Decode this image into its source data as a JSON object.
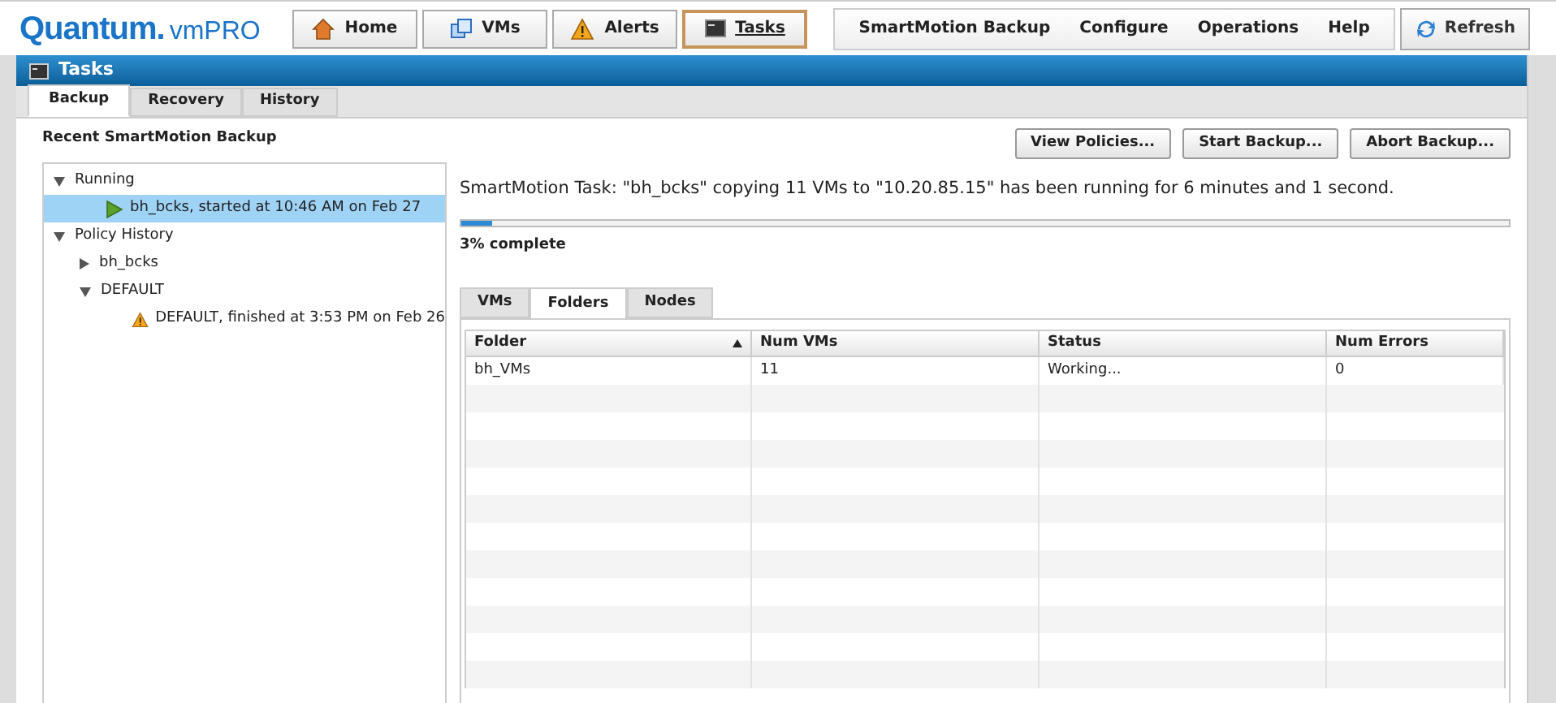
{
  "logo": {
    "brand": "Quantum.",
    "product": "vmPRO"
  },
  "nav": [
    {
      "label": "Home",
      "kind": "home",
      "selected": false
    },
    {
      "label": "VMs",
      "kind": "vms",
      "selected": false
    },
    {
      "label": "Alerts",
      "kind": "alert",
      "selected": false
    },
    {
      "label": "Tasks",
      "kind": "tasks",
      "selected": true
    }
  ],
  "menu": [
    "SmartMotion Backup",
    "Configure",
    "Operations",
    "Help"
  ],
  "refresh": "Refresh",
  "title_bar": "Tasks",
  "tabs": [
    {
      "label": "Backup",
      "selected": true
    },
    {
      "label": "Recovery",
      "selected": false
    },
    {
      "label": "History",
      "selected": false
    }
  ],
  "sidebar": {
    "title": "Recent SmartMotion Backup",
    "tree": [
      {
        "label": "Running",
        "expanded": true,
        "children": [
          {
            "label": "bh_bcks, started at 10:46 AM on Feb 27",
            "kind": "running",
            "selected": true
          }
        ]
      },
      {
        "label": "Policy History",
        "expanded": true,
        "children": [
          {
            "label": "bh_bcks",
            "expanded": false
          },
          {
            "label": "DEFAULT",
            "expanded": true,
            "children": [
              {
                "label": "DEFAULT, finished at 3:53 PM on Feb 26",
                "kind": "warning",
                "selected": false
              }
            ]
          }
        ]
      }
    ]
  },
  "actions": [
    "View Policies...",
    "Start Backup...",
    "Abort Backup..."
  ],
  "task_message": "SmartMotion Task: \"bh_bcks\" copying 11 VMs to \"10.20.85.15\" has been running for 6 minutes and 1 second.",
  "progress": {
    "level": 0.03,
    "label": "3% complete"
  },
  "detail_tabs": [
    {
      "label": "VMs",
      "selected": false
    },
    {
      "label": "Folders",
      "selected": true
    },
    {
      "label": "Nodes",
      "selected": false
    }
  ],
  "table": {
    "columns": [
      {
        "label": "Folder",
        "sorted": true
      },
      {
        "label": "Num VMs",
        "sorted": false
      },
      {
        "label": "Status",
        "sorted": false
      },
      {
        "label": "Num Errors",
        "sorted": false
      }
    ],
    "rows": [
      [
        "bh_VMs",
        "11",
        "Working...",
        "0"
      ]
    ]
  }
}
